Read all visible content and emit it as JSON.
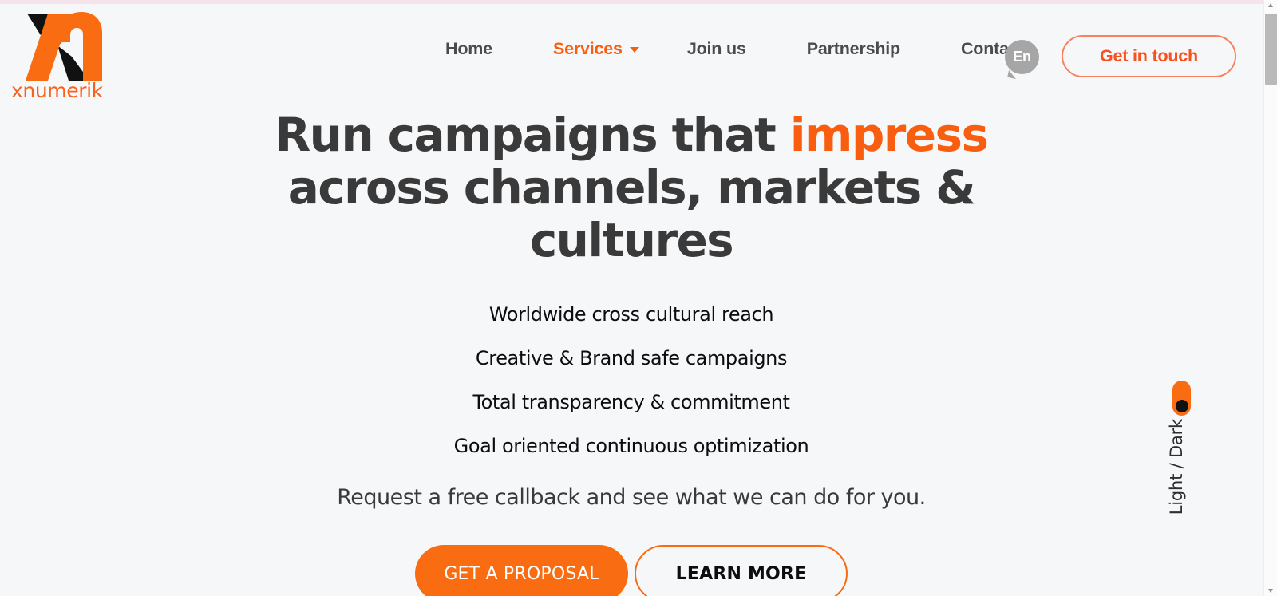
{
  "brand": {
    "wordmark": "xnumerik",
    "logo_icon": "xnumerik-logo-icon",
    "orange": "#f96c11",
    "accent_orange": "#f95d10",
    "dark": "#3a3a3a"
  },
  "nav": {
    "items": [
      {
        "label": "Home",
        "active": false,
        "has_caret": false
      },
      {
        "label": "Services",
        "active": true,
        "has_caret": true
      },
      {
        "label": "Join us",
        "active": false,
        "has_caret": false
      },
      {
        "label": "Partnership",
        "active": false,
        "has_caret": false
      },
      {
        "label": "Contact",
        "active": false,
        "has_caret": false
      }
    ],
    "language": "En",
    "cta_label": "Get in touch"
  },
  "hero": {
    "headline_part1": "Run campaigns that ",
    "headline_accent": "impress",
    "headline_part2": " across channels, markets & cultures",
    "bullets": [
      "Worldwide cross cultural reach",
      "Creative & Brand safe campaigns",
      "Total transparency & commitment",
      "Goal oriented continuous optimization"
    ],
    "subtitle": "Request a free callback and see what we can do for you.",
    "primary_cta": "GET A PROPOSAL",
    "secondary_cta": "LEARN MORE"
  },
  "theme_toggle": {
    "label": "Light / Dark",
    "state": "light"
  },
  "page": {
    "background": "#f6f7f9",
    "top_strip_color": "#f4e3ea"
  }
}
